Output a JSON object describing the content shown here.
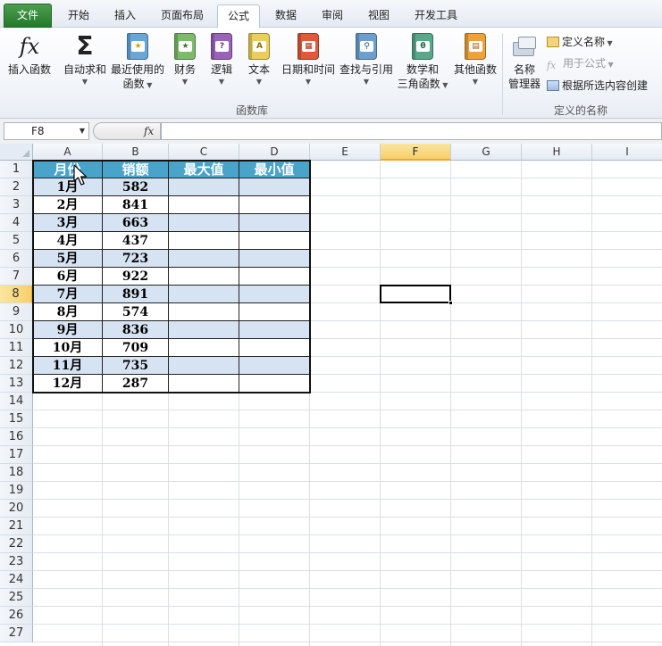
{
  "tabs": [
    {
      "label": "文件",
      "kind": "file"
    },
    {
      "label": "开始"
    },
    {
      "label": "插入"
    },
    {
      "label": "页面布局"
    },
    {
      "label": "公式",
      "active": true
    },
    {
      "label": "数据"
    },
    {
      "label": "审阅"
    },
    {
      "label": "视图"
    },
    {
      "label": "开发工具"
    }
  ],
  "ribbon": {
    "insert_function": "插入函数",
    "autosum": {
      "line1": "自动求和"
    },
    "recent": {
      "line1": "最近使用的",
      "line2": "函数"
    },
    "finance": "财务",
    "logic": "逻辑",
    "text": "文本",
    "datetime": "日期和时间",
    "lookup": "查找与引用",
    "math": {
      "line1": "数学和",
      "line2": "三角函数"
    },
    "other": "其他函数",
    "group_library": "函数库",
    "name_manager": {
      "line1": "名称",
      "line2": "管理器"
    },
    "define_name": "定义名称",
    "use_in_formula": "用于公式",
    "create_from_selection": "根据所选内容创建",
    "group_defined_names": "定义的名称",
    "icon_glyphs": {
      "fx": "fx",
      "sigma": "Σ",
      "finance": "★",
      "logic": "?",
      "text": "A",
      "datetime": "▦",
      "lookup": "⚲",
      "math": "θ",
      "other": "▤"
    }
  },
  "formula_bar": {
    "name_box": "F8",
    "fx_label": "fx",
    "formula": ""
  },
  "sheet": {
    "columns": [
      "A",
      "B",
      "C",
      "D",
      "E",
      "F",
      "G",
      "H",
      "I"
    ],
    "selected_column": "F",
    "row_numbers": [
      "1",
      "2",
      "3",
      "4",
      "5",
      "6",
      "7",
      "8",
      "9",
      "10",
      "11",
      "12",
      "13",
      "14",
      "15",
      "16",
      "17",
      "18",
      "19",
      "20",
      "21",
      "22",
      "23",
      "24",
      "25",
      "26",
      "27"
    ],
    "selected_row": "8",
    "table_headers": [
      "月份",
      "销额",
      "最大值",
      "最小值"
    ],
    "rows": [
      {
        "month": "1月",
        "sales": "582"
      },
      {
        "month": "2月",
        "sales": "841"
      },
      {
        "month": "3月",
        "sales": "663"
      },
      {
        "month": "4月",
        "sales": "437"
      },
      {
        "month": "5月",
        "sales": "723"
      },
      {
        "month": "6月",
        "sales": "922"
      },
      {
        "month": "7月",
        "sales": "891"
      },
      {
        "month": "8月",
        "sales": "574"
      },
      {
        "month": "9月",
        "sales": "836"
      },
      {
        "month": "10月",
        "sales": "709"
      },
      {
        "month": "11月",
        "sales": "735"
      },
      {
        "month": "12月",
        "sales": "287"
      }
    ],
    "active_cell": "F8"
  },
  "colors": {
    "header_fill": "#4aa3c8",
    "band_fill": "#d6e3f2",
    "selection_highlight": "#f7cf6a",
    "file_tab": "#2f8a36"
  }
}
